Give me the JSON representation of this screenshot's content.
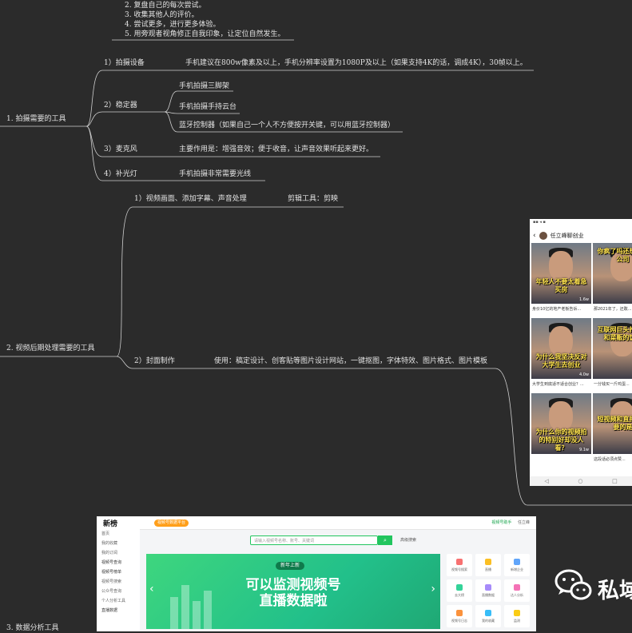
{
  "colors": {
    "background": "#2b2b2b",
    "line": "#cfcfcf",
    "text": "#e2e2e2",
    "accent_green": "#22c55e"
  },
  "top_list": [
    "2. 复盘自己的每次尝试。",
    "3. 收集其他人的评价。",
    "4. 尝试更多，进行更多体验。",
    "5. 用旁观者视角修正自我印象，让定位自然发生。"
  ],
  "section1": {
    "title": "1. 拍摄需要的工具",
    "items": [
      {
        "label": "1）拍摄设备",
        "details": [
          "手机建议在800w像素及以上，手机分辨率设置为1080P及以上（如果支持4K的话，调成4K），30帧以上。"
        ]
      },
      {
        "label": "2）稳定器",
        "details": [
          "手机拍摄三脚架",
          "手机拍摄手持云台",
          "蓝牙控制器（如果自己一个人不方便按开关键，可以用蓝牙控制器）"
        ]
      },
      {
        "label": "3）麦克风",
        "details": [
          "主要作用是：增强音效；便于收音，让声音效果听起来更好。"
        ]
      },
      {
        "label": "4）补光灯",
        "details": [
          "手机拍摄非常需要光线"
        ]
      }
    ]
  },
  "section2": {
    "title": "2. 视频后期处理需要的工具",
    "items": [
      {
        "label": "1）视频画面、添加字幕、声音处理",
        "detail": "剪辑工具：剪映"
      },
      {
        "label": "2）封面制作",
        "detail": "使用：稿定设计、创客贴等图片设计网站，一键抠图，字体特效、图片格式、图片模板"
      }
    ]
  },
  "section3": {
    "title": "3. 数据分析工具"
  },
  "phone": {
    "account": "任立峰聊创业",
    "thumbs": [
      {
        "caption": "年轻人不要太着急买房",
        "likes": "1.6w",
        "title": "身价10亿的地产老板告诉..."
      },
      {
        "caption": "你疯了吗还想着开公司",
        "likes": "",
        "title": "那2021年了，还敢..."
      },
      {
        "caption": "为什么我坚决反对大学生去创业",
        "likes": "4.0w",
        "title": "大学生到底适不适合创业？..."
      },
      {
        "caption": "互联网巨头抢菜农和菜贩的饭碗",
        "likes": "",
        "title": "一分钱买一斤鸡蛋..."
      },
      {
        "caption": "为什么你的视频拍的特别好却没人看？",
        "likes": "9.1w",
        "title": ""
      },
      {
        "caption": "短视频和直播最重要的是",
        "likes": "",
        "title": "这段话必须点赞..."
      }
    ]
  },
  "web": {
    "logo": "新榜",
    "pill": "视频号数据平台",
    "top_right_links": [
      "视频号助手",
      "任立峰"
    ],
    "sidebar": [
      "首页",
      "我的收藏",
      "我的订阅",
      "视频号查询",
      "视频号榜单",
      "视频号搜索",
      "公众号查询",
      "个人分析工具",
      "直播数据"
    ],
    "search_placeholder": "请输入视频号名称、账号、关键词",
    "advanced_search": "高级搜索",
    "banner_tag": "新年上新",
    "banner_line1": "可以监测视频号",
    "banner_line2": "直播数据啦",
    "tiles": [
      "视频号搜索",
      "直播",
      "新增企业",
      "去大榜",
      "直播数据",
      "达人分析",
      "视频号日志",
      "我的收藏",
      "监测"
    ]
  },
  "watermark": {
    "text": "私域"
  }
}
